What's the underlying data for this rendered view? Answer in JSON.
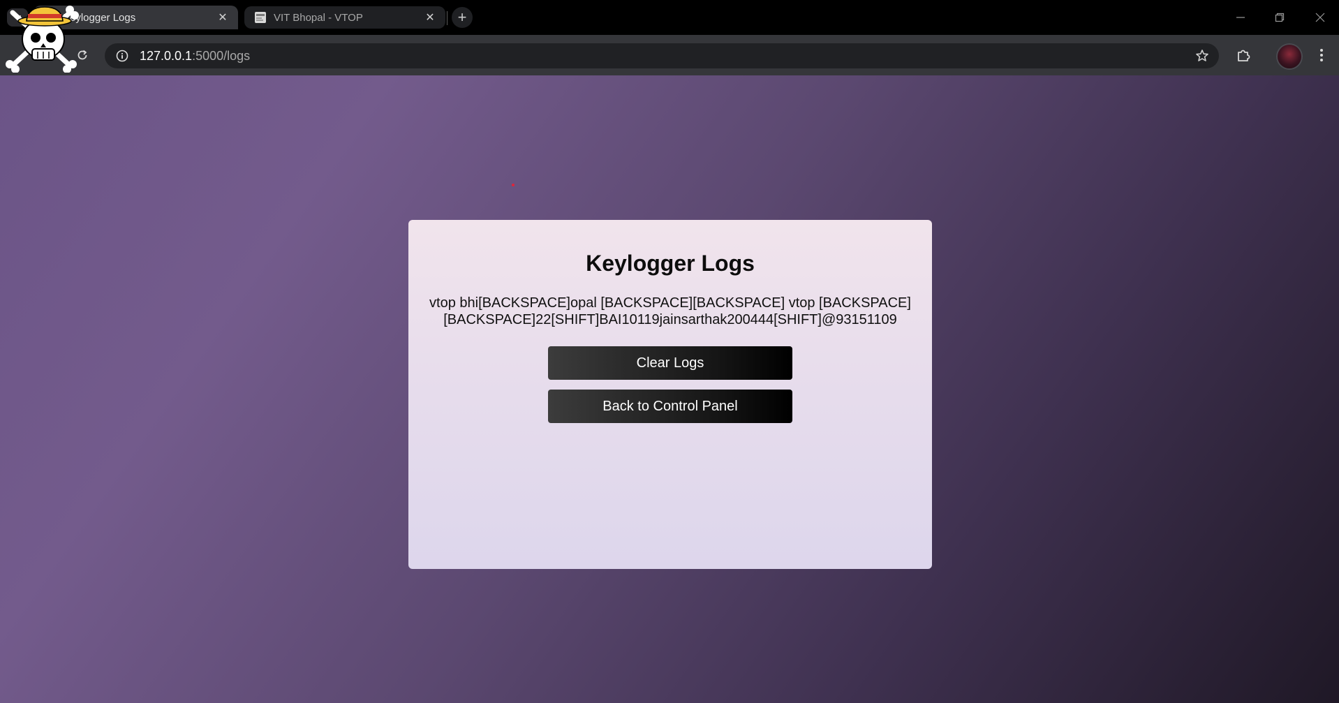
{
  "browser": {
    "tabs": [
      {
        "title": "Keylogger Logs",
        "active": true
      },
      {
        "title": "VIT Bhopal - VTOP",
        "active": false
      }
    ],
    "address_bar": {
      "host": "127.0.0.1",
      "path": ":5000/logs"
    }
  },
  "page": {
    "title": "Keylogger Logs",
    "log_text": "vtop bhi[BACKSPACE]opal [BACKSPACE][BACKSPACE] vtop [BACKSPACE][BACKSPACE]22[SHIFT]BAI10119jainsarthak200444[SHIFT]@93151109",
    "buttons": {
      "clear": "Clear Logs",
      "back": "Back to Control Panel"
    }
  },
  "colors": {
    "background_gradient_start": "#735b8c",
    "background_gradient_end": "#1f1826",
    "card_background": "#ebe0ec",
    "button_background": "#151515",
    "button_text": "#ffffff"
  },
  "icons": {
    "tab_search": "chevron-down-icon",
    "reload": "reload-icon",
    "site_info": "info-icon",
    "bookmark": "star-icon",
    "extensions": "puzzle-icon",
    "menu": "kebab-menu-icon"
  }
}
